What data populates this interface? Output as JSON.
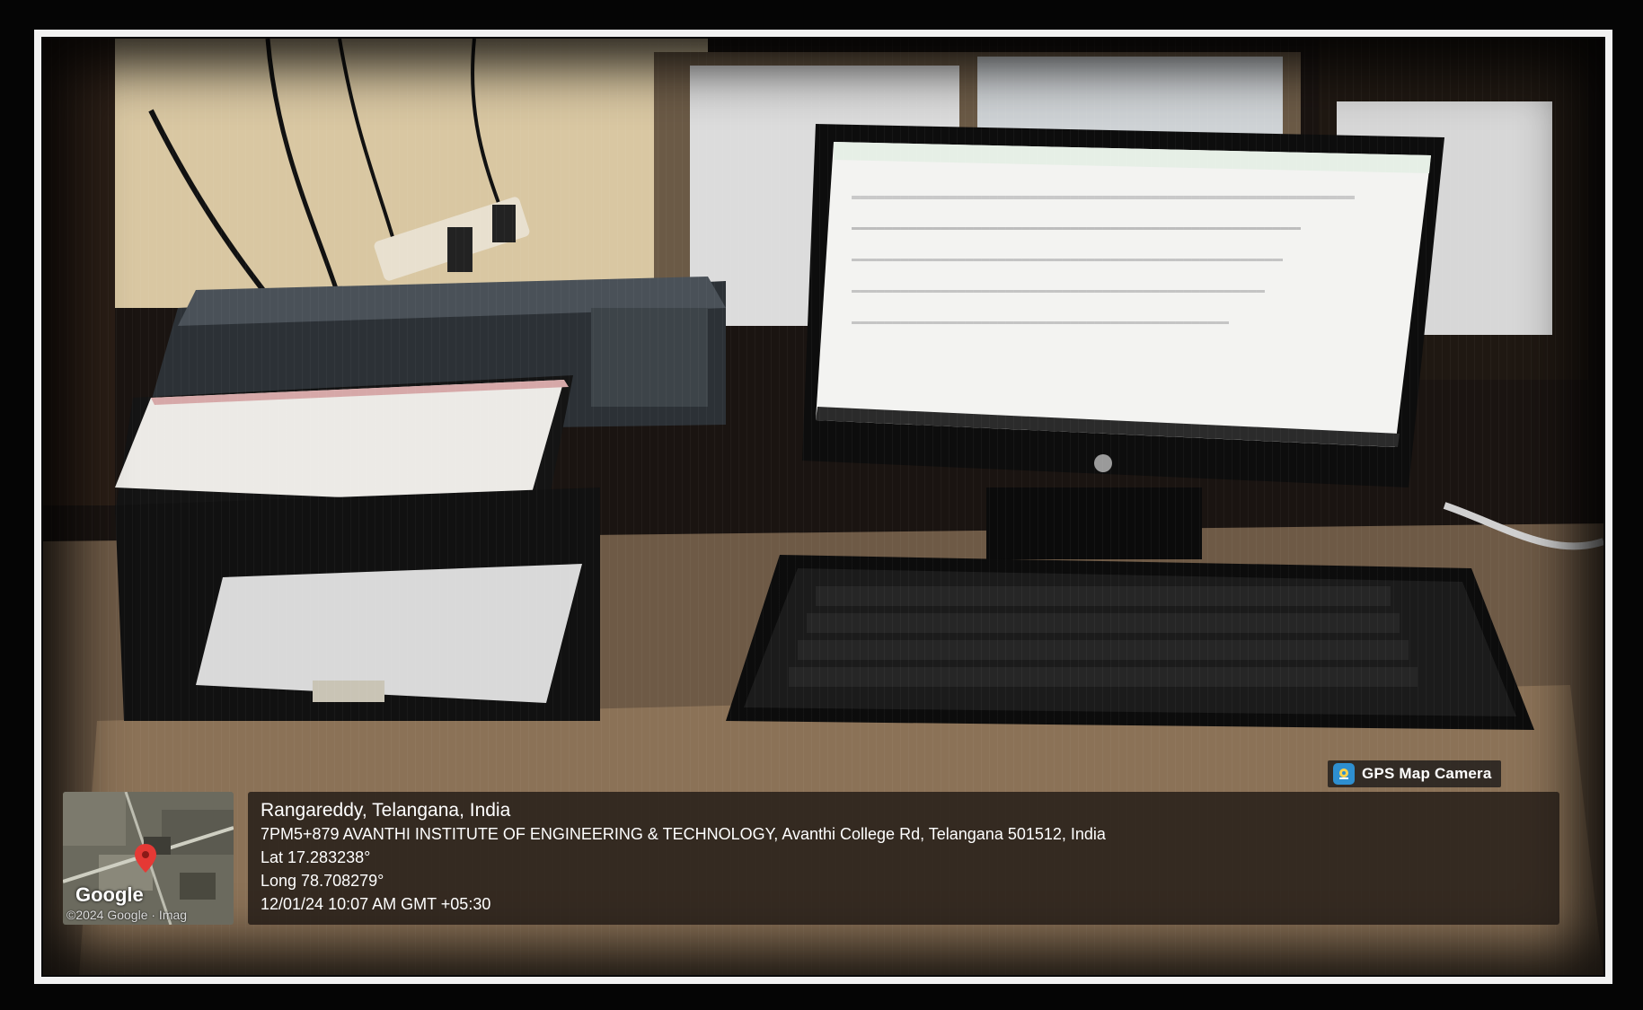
{
  "overlay": {
    "badge_label": "GPS Map Camera",
    "badge_icon": "gps-camera-icon",
    "location_title": "Rangareddy, Telangana, India",
    "address": "7PM5+879 AVANTHI INSTITUTE OF ENGINEERING & TECHNOLOGY, Avanthi College Rd, Telangana 501512, India",
    "latitude": "Lat 17.283238°",
    "longitude": "Long 78.708279°",
    "datetime": "12/01/24 10:07 AM GMT +05:30",
    "map_logo": "Google",
    "map_copyright": "©2024 Google · Imag"
  },
  "colors": {
    "frame": "#f2f2f2",
    "background": "#050505",
    "badge_icon": "#2e8fd0",
    "map_pin": "#e53935"
  }
}
